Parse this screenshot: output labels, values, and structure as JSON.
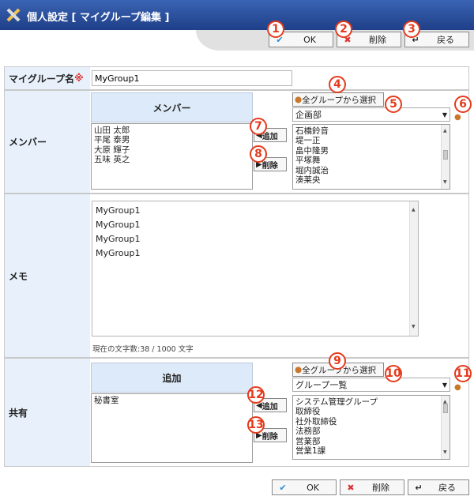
{
  "title": "個人設定 [ マイグループ編集 ]",
  "toolbar": {
    "ok_label": "OK",
    "delete_label": "削除",
    "back_label": "戻る",
    "ok_icon": "check-icon",
    "delete_icon": "x-icon",
    "back_icon": "return-arrow-icon"
  },
  "callouts": [
    "1",
    "2",
    "3",
    "4",
    "5",
    "6",
    "7",
    "8",
    "9",
    "10",
    "11",
    "12",
    "13"
  ],
  "group_name": {
    "label": "マイグループ名",
    "required_mark": "※",
    "value": "MyGroup1"
  },
  "member": {
    "label": "メンバー",
    "header": "メンバー",
    "selected": [
      "山田 太郎",
      "平尾 泰男",
      "大原 輝子",
      "五味 英之"
    ],
    "add_label": "追加",
    "remove_label": "削除",
    "group_select_button": "全グループから選択",
    "dropdown_value": "企画部",
    "candidates": [
      "石橋鈴音",
      "堤一正",
      "畠中隆男",
      "平塚舞",
      "堀内誠治",
      "湊莱央"
    ]
  },
  "memo": {
    "label": "メモ",
    "lines": [
      "MyGroup1",
      "MyGroup1",
      "MyGroup1",
      "MyGroup1"
    ],
    "counter": "現在の文字数:38 / 1000 文字"
  },
  "share": {
    "label": "共有",
    "header": "追加",
    "selected": [
      "秘書室"
    ],
    "add_label": "追加",
    "remove_label": "削除",
    "group_select_button": "全グループから選択",
    "dropdown_value": "グループ一覧",
    "candidates": [
      "システム管理グループ",
      "取締役",
      "社外取締役",
      "法務部",
      "営業部",
      "営業1課"
    ]
  },
  "colors": {
    "accent": "#e53a1c",
    "titlebar": "#2a4d9c",
    "label_bg": "#e8f1fb"
  }
}
